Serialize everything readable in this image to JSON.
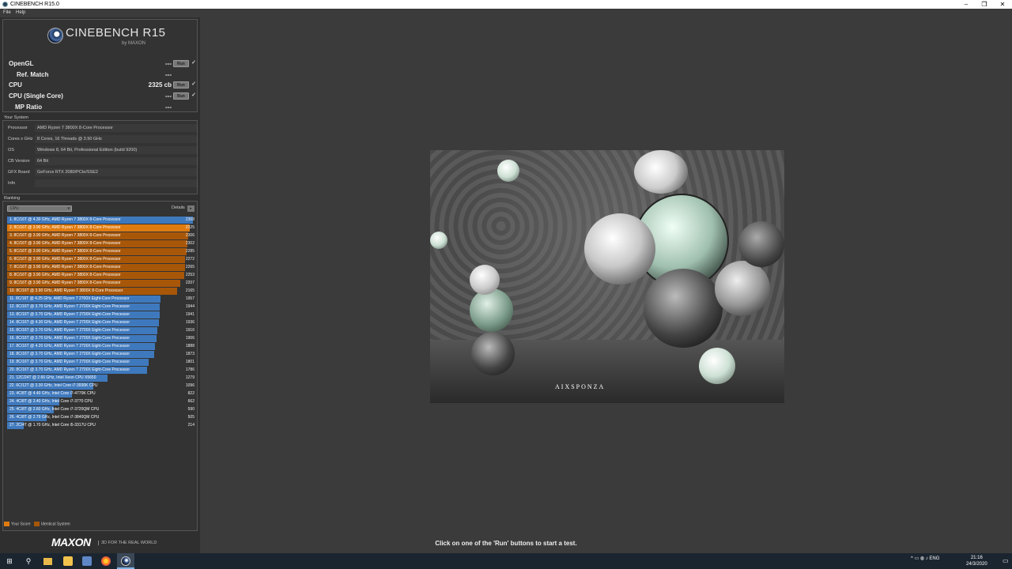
{
  "window": {
    "title": "CINEBENCH R15.0",
    "minimize": "–",
    "maximize": "❐",
    "close": "✕"
  },
  "menu": {
    "file": "File",
    "help": "Help"
  },
  "logo": {
    "name": "CINEBENCH R15",
    "by": "by MAXON"
  },
  "scores": [
    {
      "label": "OpenGL",
      "value": "---",
      "run": "Run",
      "check": "✓"
    },
    {
      "label": "Ref. Match",
      "value": "---"
    },
    {
      "label": "CPU",
      "value": "2325 cb",
      "run": "Run",
      "check": "✓"
    },
    {
      "label": "CPU (Single Core)",
      "value": "---",
      "run": "Run",
      "check": "✓"
    },
    {
      "label": "MP Ratio",
      "value": "---"
    }
  ],
  "your_system": {
    "label": "Your System",
    "rows": [
      {
        "k": "Processor",
        "v": "AMD Ryzen 7 3800X 8-Core Processor"
      },
      {
        "k": "Cores x GHz",
        "v": "8 Cores, 16 Threads @ 3.90 GHz"
      },
      {
        "k": "OS",
        "v": "Windows 8, 64 Bit, Professional Edition (build 9200)"
      },
      {
        "k": "CB Version",
        "v": "64 Bit"
      },
      {
        "k": "GFX Board",
        "v": "GeForce RTX 2080/PCIe/SSE2"
      },
      {
        "k": "Info",
        "v": ""
      }
    ]
  },
  "ranking": {
    "label": "Ranking",
    "dropdown": "CPU",
    "dropdown_arrow": "▾",
    "details": "Details",
    "details_btn": "▸",
    "max": 2368,
    "rows": [
      {
        "text": "1. 8C/16T @ 4.30 GHz, AMD Ryzen 7 3800X 8-Core Processor",
        "score": "2368",
        "value": 2368,
        "color": "#3f79bd"
      },
      {
        "text": "2. 8C/16T @ 3.90 GHz, AMD Ryzen 7 3800X 8-Core Processor",
        "score": "2325",
        "value": 2325,
        "color": "#e07b10"
      },
      {
        "text": "3. 8C/16T @ 3.90 GHz, AMD Ryzen 7 3800X 8-Core Processor",
        "score": "2306",
        "value": 2306,
        "color": "#a85709"
      },
      {
        "text": "4. 8C/16T @ 3.90 GHz, AMD Ryzen 7 3800X 8-Core Processor",
        "score": "2302",
        "value": 2302,
        "color": "#a85709"
      },
      {
        "text": "5. 8C/16T @ 3.90 GHz, AMD Ryzen 7 3800X 8-Core Processor",
        "score": "2285",
        "value": 2285,
        "color": "#a85709"
      },
      {
        "text": "6. 8C/16T @ 3.90 GHz, AMD Ryzen 7 3800X 8-Core Processor",
        "score": "2272",
        "value": 2272,
        "color": "#a85709"
      },
      {
        "text": "7. 8C/16T @ 3.90 GHz, AMD Ryzen 7 3800X 8-Core Processor",
        "score": "2265",
        "value": 2265,
        "color": "#a85709"
      },
      {
        "text": "8. 8C/16T @ 3.90 GHz, AMD Ryzen 7 3800X 8-Core Processor",
        "score": "2253",
        "value": 2253,
        "color": "#a85709"
      },
      {
        "text": "9. 8C/16T @ 3.90 GHz, AMD Ryzen 7 3800X 8-Core Processor",
        "score": "2207",
        "value": 2207,
        "color": "#a85709"
      },
      {
        "text": "10. 8C/16T @ 3.90 GHz, AMD Ryzen 7 3800X 8-Core Processor",
        "score": "2165",
        "value": 2165,
        "color": "#a85709"
      },
      {
        "text": "11. 8C/16T @ 4.25 GHz, AMD Ryzen 7 2700X Eight-Core Processor",
        "score": "1957",
        "value": 1957,
        "color": "#3f79bd"
      },
      {
        "text": "12. 8C/16T @ 3.70 GHz, AMD Ryzen 7 2700X Eight-Core Processor",
        "score": "1944",
        "value": 1944,
        "color": "#3f79bd"
      },
      {
        "text": "13. 8C/16T @ 3.70 GHz, AMD Ryzen 7 2700X Eight-Core Processor",
        "score": "1941",
        "value": 1941,
        "color": "#3f79bd"
      },
      {
        "text": "14. 8C/16T @ 4.30 GHz, AMD Ryzen 7 2700X Eight-Core Processor",
        "score": "1936",
        "value": 1936,
        "color": "#3f79bd"
      },
      {
        "text": "15. 8C/16T @ 3.70 GHz, AMD Ryzen 7 2700X Eight-Core Processor",
        "score": "1916",
        "value": 1916,
        "color": "#3f79bd"
      },
      {
        "text": "16. 8C/16T @ 3.70 GHz, AMD Ryzen 7 2700X Eight-Core Processor",
        "score": "1906",
        "value": 1906,
        "color": "#3f79bd"
      },
      {
        "text": "17. 8C/16T @ 4.20 GHz, AMD Ryzen 7 2700X Eight-Core Processor",
        "score": "1888",
        "value": 1888,
        "color": "#3f79bd"
      },
      {
        "text": "18. 8C/16T @ 3.70 GHz, AMD Ryzen 7 2700X Eight-Core Processor",
        "score": "1873",
        "value": 1873,
        "color": "#3f79bd"
      },
      {
        "text": "19. 8C/16T @ 3.70 GHz, AMD Ryzen 7 2700X Eight-Core Processor",
        "score": "1801",
        "value": 1801,
        "color": "#3f79bd"
      },
      {
        "text": "20. 8C/16T @ 3.70 GHz, AMD Ryzen 7 2700X Eight-Core Processor",
        "score": "1786",
        "value": 1786,
        "color": "#3f79bd"
      },
      {
        "text": "21. 12C/24T @ 2.66 GHz, Intel Xeon CPU X5650",
        "score": "1279",
        "value": 1279,
        "color": "#3f79bd"
      },
      {
        "text": "22. 6C/12T @ 3.30 GHz,  Intel Core i7-3930K CPU",
        "score": "1096",
        "value": 1096,
        "color": "#3f79bd"
      },
      {
        "text": "23. 4C/8T @ 4.40 GHz, Intel Core i7-4770K CPU",
        "score": "822",
        "value": 822,
        "color": "#3f79bd"
      },
      {
        "text": "24. 4C/8T @ 3.40 GHz,  Intel Core i7-3770 CPU",
        "score": "662",
        "value": 662,
        "color": "#3f79bd"
      },
      {
        "text": "25. 4C/8T @ 2.60 GHz,  Intel Core i7-3720QM CPU",
        "score": "590",
        "value": 590,
        "color": "#3f79bd"
      },
      {
        "text": "26. 4C/8T @ 2.79 GHz,  Intel Core i7-3840QM CPU",
        "score": "505",
        "value": 505,
        "color": "#3f79bd"
      },
      {
        "text": "27. 2C/4T @ 1.70 GHz,  Intel Core i5-3317U CPU",
        "score": "214",
        "value": 214,
        "color": "#3f79bd"
      }
    ]
  },
  "legend": {
    "your_score": "Your Score",
    "identical": "Identical System",
    "your_color": "#e07b10",
    "identical_color": "#a85709"
  },
  "footer": {
    "brand": "MAXON",
    "tagline": "3D FOR THE REAL WORLD"
  },
  "render": {
    "brand": "AIXSPONZA"
  },
  "status": "Click on one of the 'Run' buttons to start a test.",
  "taskbar": {
    "start": "⊞",
    "search": "⚲",
    "tray": "^  ▭  ◍  ♪  ENG",
    "time": "21:16",
    "date": "24/3/2020"
  }
}
